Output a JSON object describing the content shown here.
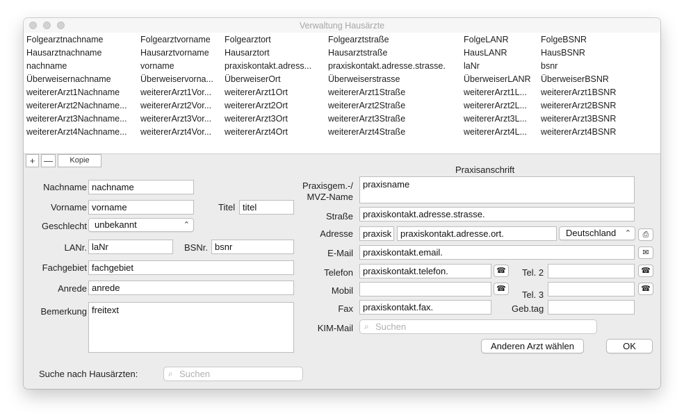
{
  "window": {
    "title": "Verwaltung Hausärzte"
  },
  "table": {
    "rows": [
      [
        "Folgearztnachname",
        "Folgearztvorname",
        "Folgearztort",
        "Folgearztstraße",
        "FolgeLANR",
        "FolgeBSNR"
      ],
      [
        "Hausarztnachname",
        "Hausarztvorname",
        "Hausarztort",
        "Hausarztstraße",
        "HausLANR",
        "HausBSNR"
      ],
      [
        "nachname",
        "vorname",
        "praxiskontakt.adress...",
        "praxiskontakt.adresse.strasse.",
        "laNr",
        "bsnr"
      ],
      [
        "Überweisernachname",
        "Überweiservorna...",
        "ÜberweiserOrt",
        "Überweiserstrasse",
        "ÜberweiserLANR",
        "ÜberweiserBSNR"
      ],
      [
        "weitererArzt1Nachname",
        "weitererArzt1Vor...",
        "weitererArzt1Ort",
        "weitererArzt1Straße",
        "weitererArzt1L...",
        "weitererArzt1BSNR"
      ],
      [
        "weitererArzt2Nachname...",
        "weitererArzt2Vor...",
        "weitererArzt2Ort",
        "weitererArzt2Straße",
        "weitererArzt2L...",
        "weitererArzt2BSNR"
      ],
      [
        "weitererArzt3Nachname...",
        "weitererArzt3Vor...",
        "weitererArzt3Ort",
        "weitererArzt3Straße",
        "weitererArzt3L...",
        "weitererArzt3BSNR"
      ],
      [
        "weitererArzt4Nachname...",
        "weitererArzt4Vor...",
        "weitererArzt4Ort",
        "weitererArzt4Straße",
        "weitererArzt4L...",
        "weitererArzt4BSNR"
      ]
    ]
  },
  "toolbar": {
    "add": "+",
    "remove": "—",
    "copy": "Kopie"
  },
  "left": {
    "nachname_label": "Nachname",
    "nachname_value": "nachname",
    "vorname_label": "Vorname",
    "vorname_value": "vorname",
    "titel_label": "Titel",
    "titel_value": "titel",
    "geschlecht_label": "Geschlecht",
    "geschlecht_value": "unbekannt",
    "lanr_label": "LANr.",
    "lanr_value": "laNr",
    "bsnr_label": "BSNr.",
    "bsnr_value": "bsnr",
    "fachgebiet_label": "Fachgebiet",
    "fachgebiet_value": "fachgebiet",
    "anrede_label": "Anrede",
    "anrede_value": "anrede",
    "bemerkung_label": "Bemerkung",
    "bemerkung_value": "freitext"
  },
  "right": {
    "section_title": "Praxisanschrift",
    "praxisname_label_1": "Praxisgem.-/",
    "praxisname_label_2": "MVZ-Name",
    "praxisname_value": "praxisname",
    "strasse_label": "Straße",
    "strasse_value": "praxiskontakt.adresse.strasse.",
    "adresse_label": "Adresse",
    "plz_value": "praxisk",
    "ort_value": "praxiskontakt.adresse.ort.",
    "land_value": "Deutschland",
    "email_label": "E-Mail",
    "email_value": "praxiskontakt.email.",
    "telefon_label": "Telefon",
    "telefon_value": "praxiskontakt.telefon.",
    "tel2_label": "Tel. 2",
    "tel2_value": "",
    "mobil_label": "Mobil",
    "mobil_value": "",
    "tel3_label": "Tel. 3",
    "tel3_value": "",
    "fax_label": "Fax",
    "fax_value": "praxiskontakt.fax.",
    "gebtag_label": "Geb.tag",
    "gebtag_value": "",
    "kim_label": "KIM-Mail",
    "kim_placeholder": "Suchen"
  },
  "buttons": {
    "anderen_arzt": "Anderen Arzt wählen",
    "ok": "OK"
  },
  "search": {
    "label": "Suche nach Hausärzten:",
    "placeholder": "Suchen"
  },
  "icons": {
    "chevron": "⌃⌄",
    "print": "🖶",
    "mail": "✉",
    "phone": "☎",
    "search": "⌕"
  }
}
